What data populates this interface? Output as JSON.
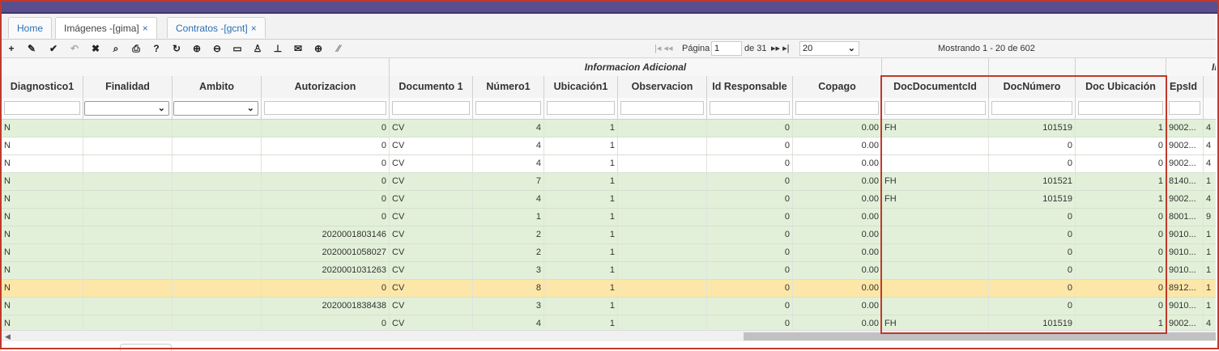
{
  "tabs": [
    {
      "label": "Home",
      "closable": false
    },
    {
      "label": "Imágenes -[gima]",
      "closable": true
    },
    {
      "label": "Contratos -[gcnt]",
      "closable": true
    }
  ],
  "toolbar": {
    "icons": [
      "add-icon",
      "edit-icon",
      "check-icon",
      "undo-icon",
      "delete-icon",
      "search-icon",
      "print-icon",
      "help-icon",
      "refresh-icon",
      "zoom-in-icon",
      "zoom-out-icon",
      "comment-icon",
      "user-icon",
      "pin-icon",
      "mail-icon",
      "plus-circle-icon",
      "resize-icon"
    ],
    "page_label": "Página",
    "page_value": "1",
    "of_label": "de 31",
    "page_size": "20",
    "showing": "Mostrando 1 - 20 de 602"
  },
  "grid": {
    "group_header": "Informacion Adicional",
    "group_header_right": "In",
    "columns": [
      "Diagnostico1",
      "Finalidad",
      "Ambito",
      "Autorizacion",
      "Documento 1",
      "Número1",
      "Ubicación1",
      "Observacion",
      "Id Responsable",
      "Copago",
      "DocDocumentcId",
      "DocNúmero",
      "Doc Ubicación",
      "EpsId",
      ""
    ],
    "rows": [
      {
        "style": "green",
        "cells": [
          "N",
          "",
          "",
          "0",
          "CV",
          "4",
          "1",
          "",
          "0",
          "0.00",
          "FH",
          "101519",
          "1",
          "9002...",
          "4"
        ]
      },
      {
        "style": "white",
        "cells": [
          "N",
          "",
          "",
          "0",
          "CV",
          "4",
          "1",
          "",
          "0",
          "0.00",
          "",
          "0",
          "0",
          "9002...",
          "4"
        ]
      },
      {
        "style": "white",
        "cells": [
          "N",
          "",
          "",
          "0",
          "CV",
          "4",
          "1",
          "",
          "0",
          "0.00",
          "",
          "0",
          "0",
          "9002...",
          "4"
        ]
      },
      {
        "style": "green",
        "cells": [
          "N",
          "",
          "",
          "0",
          "CV",
          "7",
          "1",
          "",
          "0",
          "0.00",
          "FH",
          "101521",
          "1",
          "8140...",
          "1"
        ]
      },
      {
        "style": "green",
        "cells": [
          "N",
          "",
          "",
          "0",
          "CV",
          "4",
          "1",
          "",
          "0",
          "0.00",
          "FH",
          "101519",
          "1",
          "9002...",
          "4"
        ]
      },
      {
        "style": "green",
        "cells": [
          "N",
          "",
          "",
          "0",
          "CV",
          "1",
          "1",
          "",
          "0",
          "0.00",
          "",
          "0",
          "0",
          "8001...",
          "9"
        ]
      },
      {
        "style": "green",
        "cells": [
          "N",
          "",
          "",
          "2020001803146",
          "CV",
          "2",
          "1",
          "",
          "0",
          "0.00",
          "",
          "0",
          "0",
          "9010...",
          "1"
        ]
      },
      {
        "style": "green",
        "cells": [
          "N",
          "",
          "",
          "2020001058027",
          "CV",
          "2",
          "1",
          "",
          "0",
          "0.00",
          "",
          "0",
          "0",
          "9010...",
          "1"
        ]
      },
      {
        "style": "green",
        "cells": [
          "N",
          "",
          "",
          "2020001031263",
          "CV",
          "3",
          "1",
          "",
          "0",
          "0.00",
          "",
          "0",
          "0",
          "9010...",
          "1"
        ]
      },
      {
        "style": "sel",
        "cells": [
          "N",
          "",
          "",
          "0",
          "CV",
          "8",
          "1",
          "",
          "0",
          "0.00",
          "",
          "0",
          "0",
          "8912...",
          "1"
        ]
      },
      {
        "style": "green",
        "cells": [
          "N",
          "",
          "",
          "2020001838438",
          "CV",
          "3",
          "1",
          "",
          "0",
          "0.00",
          "",
          "0",
          "0",
          "9010...",
          "1"
        ]
      },
      {
        "style": "green",
        "cells": [
          "N",
          "",
          "",
          "0",
          "CV",
          "4",
          "1",
          "",
          "0",
          "0.00",
          "FH",
          "101519",
          "1",
          "9002...",
          "4"
        ]
      }
    ]
  },
  "colors": {
    "topbar": "#5a4e8c",
    "row_green": "#e2f0d9",
    "row_selected": "#fce7a8",
    "highlight_border": "#c0392b",
    "tab_link": "#2a6fb5"
  }
}
